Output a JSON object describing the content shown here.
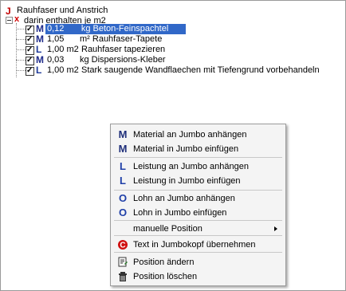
{
  "tree": {
    "root": {
      "icon": "J",
      "label": "Rauhfaser und Anstrich"
    },
    "group": {
      "icon": "x",
      "label": "darin enthalten je m2"
    },
    "items": [
      {
        "type": "M",
        "qty": "0,12",
        "unit_text": "kg Beton-Feinspachtel",
        "selected": true
      },
      {
        "type": "M",
        "qty": "1,05",
        "unit_text": "m² Rauhfaser-Tapete"
      },
      {
        "type": "L",
        "qty": "1,00 m2",
        "unit_text": "Rauhfaser tapezieren"
      },
      {
        "type": "M",
        "qty": "0,03",
        "unit_text": "kg Dispersions-Kleber"
      },
      {
        "type": "L",
        "qty": "1,00 m2",
        "unit_text": "Stark saugende Wandflaechen mit Tiefengrund vorbehandeln"
      }
    ]
  },
  "context_menu": {
    "items": [
      {
        "icon": "M",
        "label": "Material an Jumbo anhängen"
      },
      {
        "icon": "M",
        "label": "Material in Jumbo einfügen"
      },
      {
        "icon": "L",
        "label": "Leistung an Jumbo anhängen"
      },
      {
        "icon": "L",
        "label": "Leistung in Jumbo einfügen"
      },
      {
        "icon": "O",
        "label": "Lohn an Jumbo anhängen"
      },
      {
        "icon": "O",
        "label": "Lohn in Jumbo einfügen"
      },
      {
        "icon": "",
        "label": "manuelle Position"
      },
      {
        "icon": "C",
        "label": "Text in Jumbokopf übernehmen"
      },
      {
        "icon": "edit-doc-icon",
        "label": "Position ändern"
      },
      {
        "icon": "trash-icon",
        "label": "Position löschen"
      }
    ]
  }
}
